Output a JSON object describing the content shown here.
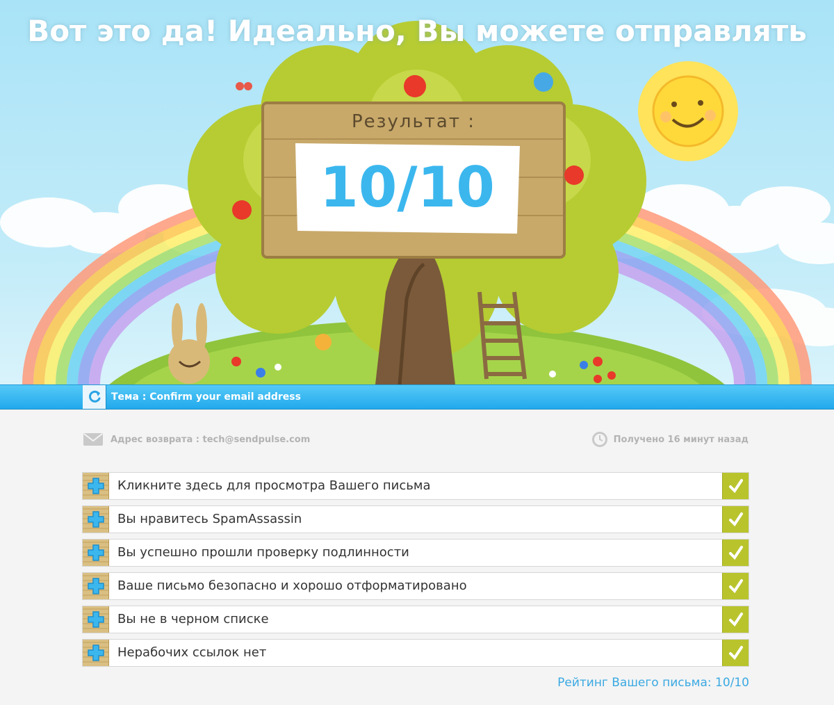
{
  "hero": {
    "title": "Вот это да! Идеально, Вы можете отправлять",
    "score_label": "Результат :",
    "score_value": "10/10"
  },
  "subject": {
    "text": "Тема : Confirm your email address",
    "refresh_icon": "refresh-icon"
  },
  "meta": {
    "return_address": "Адрес возврата : tech@sendpulse.com",
    "received": "Получено 16 минут назад",
    "mail_icon": "envelope-icon",
    "clock_icon": "clock-icon"
  },
  "checks": [
    {
      "label": "Кликните здесь для просмотра Вашего письма",
      "status": "passed"
    },
    {
      "label": "Вы нравитесь SpamAssassin",
      "status": "passed"
    },
    {
      "label": "Вы успешно прошли проверку подлинности",
      "status": "passed"
    },
    {
      "label": "Ваше письмо безопасно и хорошо отформатировано",
      "status": "passed"
    },
    {
      "label": "Вы не в черном списке",
      "status": "passed"
    },
    {
      "label": "Нерабочих ссылок нет",
      "status": "passed"
    }
  ],
  "rating": "Рейтинг Вашего письма: 10/10",
  "colors": {
    "accent_blue": "#3bb7ee",
    "subject_bar": "#22a9ec",
    "tick_green": "#b9c42d",
    "wood": "#d9bf83"
  }
}
